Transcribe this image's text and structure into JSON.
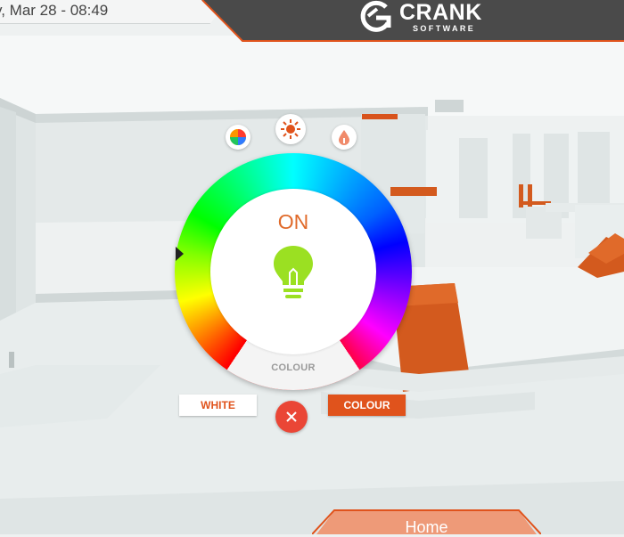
{
  "status_bar": {
    "datetime": "y, Mar 28 - 08:49"
  },
  "brand": {
    "name": "CRANK",
    "subtitle": "SOFTWARE"
  },
  "light_control": {
    "modes": [
      {
        "name": "colour-mode",
        "icon": "colour-wheel-icon"
      },
      {
        "name": "brightness-mode",
        "icon": "sun-icon"
      },
      {
        "name": "temperature-mode",
        "icon": "drop-icon"
      }
    ],
    "status": "ON",
    "wheel_label": "COLOUR",
    "white_button": "WHITE",
    "colour_button": "COLOUR"
  },
  "nav": {
    "home_label": "Home"
  },
  "colors": {
    "accent": "#e0531c",
    "bulb": "#9be022",
    "close": "#ea4636"
  }
}
